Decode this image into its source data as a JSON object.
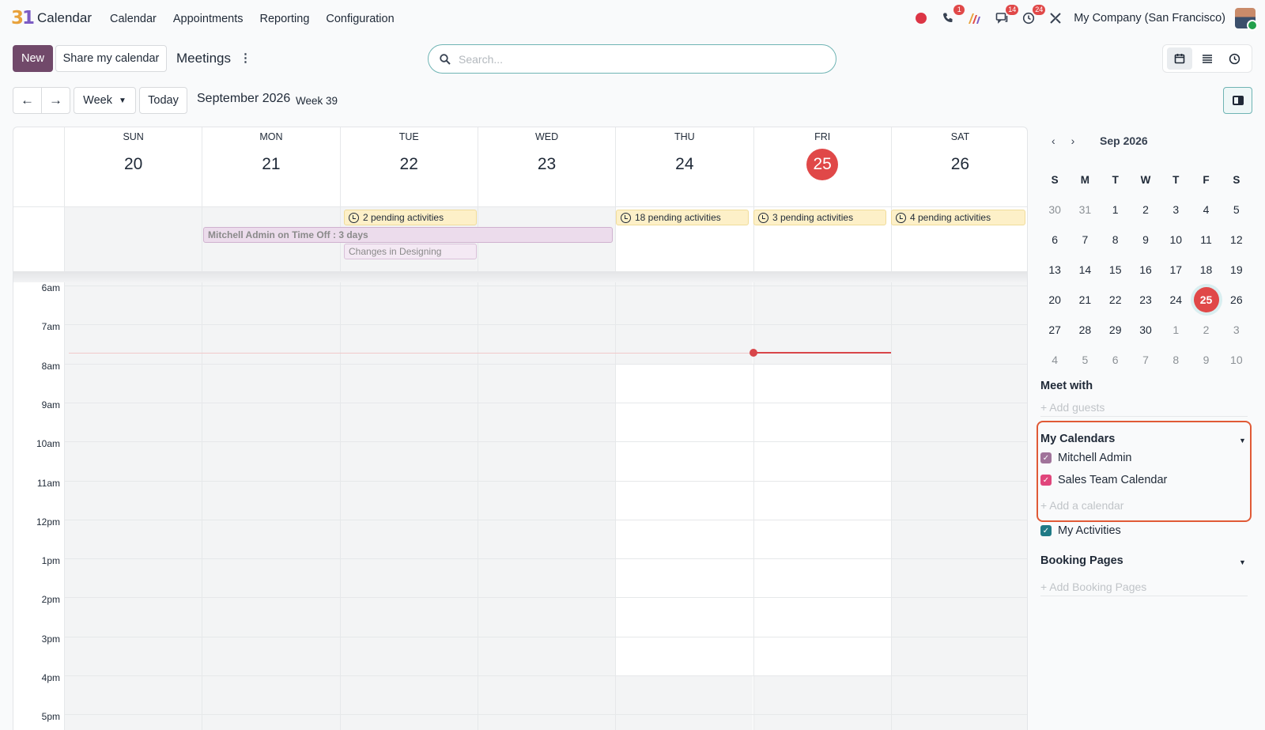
{
  "app": {
    "logo": "31",
    "name": "Calendar"
  },
  "nav": {
    "items": [
      "Calendar",
      "Appointments",
      "Reporting",
      "Configuration"
    ]
  },
  "systray": {
    "phone_badge": "1",
    "chat_badge": "14",
    "activity_badge": "24",
    "company": "My Company (San Francisco)"
  },
  "toolbar": {
    "new_label": "New",
    "share_label": "Share my calendar",
    "breadcrumb": "Meetings",
    "kebab": "⋮",
    "search_placeholder": "Search...",
    "prev_label": "←",
    "next_label": "→",
    "scale_label": "Week",
    "today_label": "Today",
    "period": "September 2026",
    "week_label": "Week 39"
  },
  "calendar": {
    "days": [
      {
        "name": "SUN",
        "num": "20"
      },
      {
        "name": "MON",
        "num": "21"
      },
      {
        "name": "TUE",
        "num": "22"
      },
      {
        "name": "WED",
        "num": "23"
      },
      {
        "name": "THU",
        "num": "24"
      },
      {
        "name": "FRI",
        "num": "25",
        "today": true
      },
      {
        "name": "SAT",
        "num": "26"
      }
    ],
    "allday_events": {
      "tue_activities": "2 pending activities",
      "thu_activities": "18 pending activities",
      "fri_activities": "3 pending activities",
      "sat_activities": "4 pending activities",
      "time_off": "Mitchell Admin on Time Off : 3 days",
      "designing": "Changes in Designing"
    },
    "hours": [
      "6am",
      "7am",
      "8am",
      "9am",
      "10am",
      "11am",
      "12pm",
      "1pm",
      "2pm",
      "3pm",
      "4pm",
      "5pm"
    ]
  },
  "sidebar": {
    "mini_prev": "‹",
    "mini_next": "›",
    "mini_title": "Sep 2026",
    "weekday_heads": [
      "S",
      "M",
      "T",
      "W",
      "T",
      "F",
      "S"
    ],
    "weeks": [
      [
        [
          "30",
          "o"
        ],
        [
          "31",
          "o"
        ],
        [
          "1",
          ""
        ],
        [
          "2",
          ""
        ],
        [
          "3",
          ""
        ],
        [
          "4",
          ""
        ],
        [
          "5",
          ""
        ]
      ],
      [
        [
          "6",
          ""
        ],
        [
          "7",
          ""
        ],
        [
          "8",
          ""
        ],
        [
          "9",
          ""
        ],
        [
          "10",
          ""
        ],
        [
          "11",
          ""
        ],
        [
          "12",
          ""
        ]
      ],
      [
        [
          "13",
          ""
        ],
        [
          "14",
          ""
        ],
        [
          "15",
          ""
        ],
        [
          "16",
          ""
        ],
        [
          "17",
          ""
        ],
        [
          "18",
          ""
        ],
        [
          "19",
          ""
        ]
      ],
      [
        [
          "20",
          ""
        ],
        [
          "21",
          ""
        ],
        [
          "22",
          ""
        ],
        [
          "23",
          ""
        ],
        [
          "24",
          ""
        ],
        [
          "25",
          "s"
        ],
        [
          "26",
          ""
        ]
      ],
      [
        [
          "27",
          ""
        ],
        [
          "28",
          ""
        ],
        [
          "29",
          ""
        ],
        [
          "30",
          ""
        ],
        [
          "1",
          "o"
        ],
        [
          "2",
          "o"
        ],
        [
          "3",
          "o"
        ]
      ],
      [
        [
          "4",
          "o"
        ],
        [
          "5",
          "o"
        ],
        [
          "6",
          "o"
        ],
        [
          "7",
          "o"
        ],
        [
          "8",
          "o"
        ],
        [
          "9",
          "o"
        ],
        [
          "10",
          "o"
        ]
      ]
    ],
    "meet_with": "Meet with",
    "add_guests": "+ Add guests",
    "my_calendars": "My Calendars",
    "cal_mitchell": "Mitchell Admin",
    "cal_sales": "Sales Team Calendar",
    "add_calendar": "+ Add a calendar",
    "my_activities": "My Activities",
    "booking_pages": "Booking Pages",
    "add_booking": "+ Add Booking Pages"
  },
  "colors": {
    "brand": "#71496a",
    "today": "#e04848",
    "highlight_border": "#e05a36",
    "mitchell": "#a0739a",
    "sales": "#e0457b",
    "activities": "#1f7a86"
  }
}
